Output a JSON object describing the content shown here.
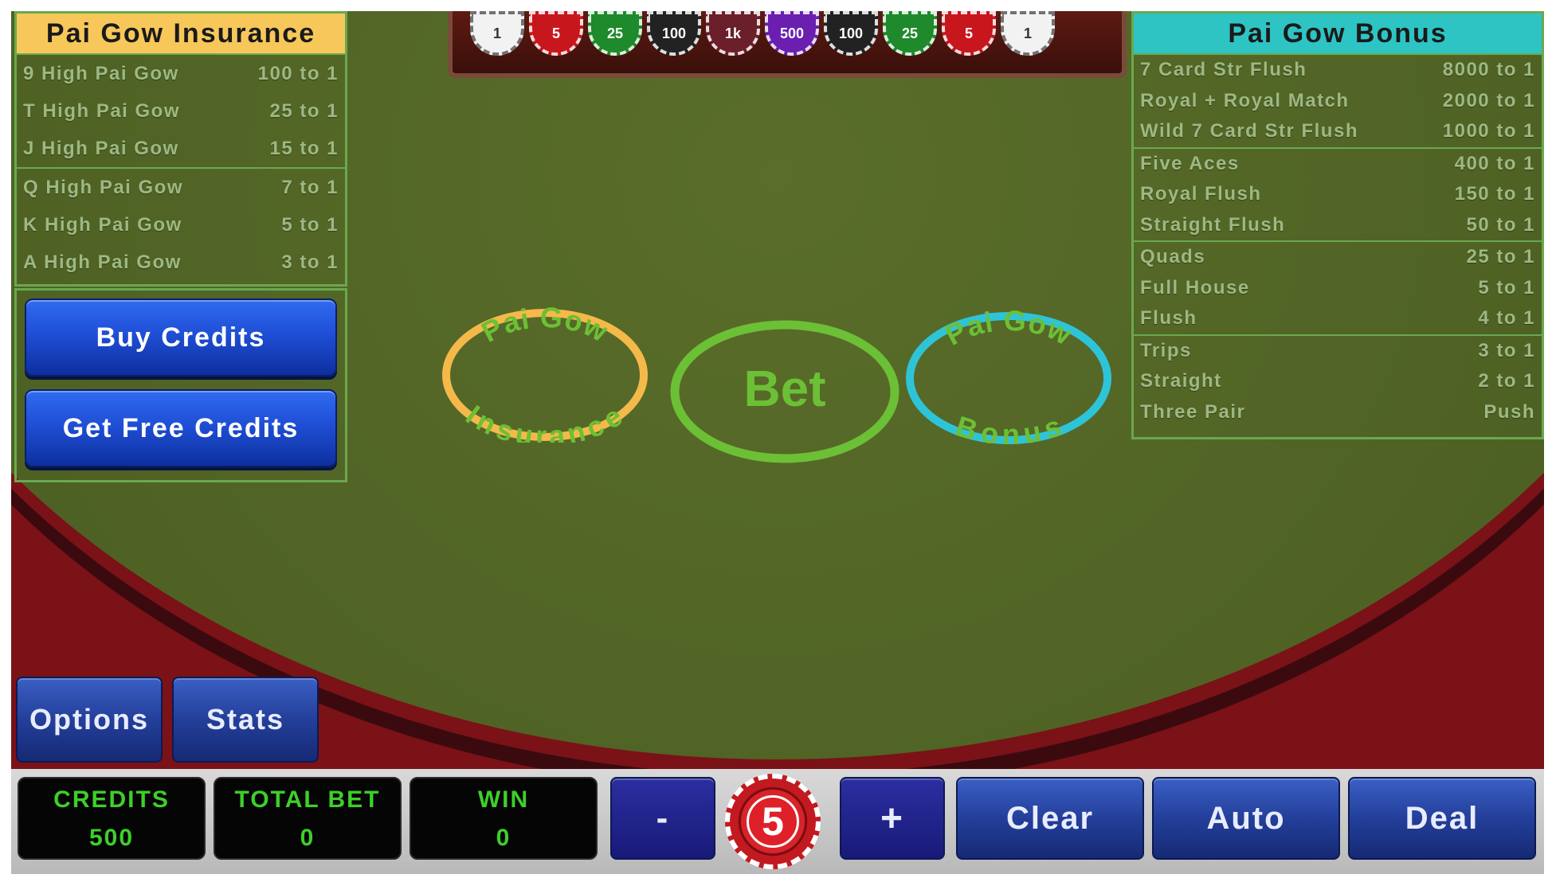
{
  "tray": {
    "chips": [
      {
        "label": "1",
        "color": "#f2f2f2"
      },
      {
        "label": "5",
        "color": "#c8161d"
      },
      {
        "label": "25",
        "color": "#1e8a2b"
      },
      {
        "label": "100",
        "color": "#222222"
      },
      {
        "label": "1k",
        "color": "#6b1f2a"
      },
      {
        "label": "500",
        "color": "#6a1fb0"
      },
      {
        "label": "100",
        "color": "#222222"
      },
      {
        "label": "25",
        "color": "#1e8a2b"
      },
      {
        "label": "5",
        "color": "#c8161d"
      },
      {
        "label": "1",
        "color": "#f2f2f2"
      }
    ]
  },
  "insurance": {
    "title": "Pai Gow Insurance",
    "header_color": "#f7c75a",
    "groups": [
      [
        {
          "hand": "9 High Pai Gow",
          "pay": "100 to 1"
        },
        {
          "hand": "T High Pai Gow",
          "pay": "25 to 1"
        },
        {
          "hand": "J High Pai Gow",
          "pay": "15 to 1"
        }
      ],
      [
        {
          "hand": "Q High Pai Gow",
          "pay": "7 to 1"
        },
        {
          "hand": "K High Pai Gow",
          "pay": "5 to 1"
        },
        {
          "hand": "A High Pai Gow",
          "pay": "3 to 1"
        }
      ]
    ]
  },
  "bonus": {
    "title": "Pai Gow Bonus",
    "header_color": "#2ec4c4",
    "groups": [
      [
        {
          "hand": "7 Card Str Flush",
          "pay": "8000 to 1"
        },
        {
          "hand": "Royal + Royal Match",
          "pay": "2000 to 1"
        },
        {
          "hand": "Wild 7 Card Str Flush",
          "pay": "1000 to 1"
        }
      ],
      [
        {
          "hand": "Five Aces",
          "pay": "400 to 1"
        },
        {
          "hand": "Royal Flush",
          "pay": "150 to 1"
        },
        {
          "hand": "Straight Flush",
          "pay": "50 to 1"
        }
      ],
      [
        {
          "hand": "Quads",
          "pay": "25 to 1"
        },
        {
          "hand": "Full House",
          "pay": "5 to 1"
        },
        {
          "hand": "Flush",
          "pay": "4 to 1"
        }
      ],
      [
        {
          "hand": "Trips",
          "pay": "3 to 1"
        },
        {
          "hand": "Straight",
          "pay": "2 to 1"
        },
        {
          "hand": "Three Pair",
          "pay": "Push"
        }
      ]
    ]
  },
  "credits_panel": {
    "buy_label": "Buy Credits",
    "free_label": "Get Free Credits"
  },
  "spots": {
    "insurance_top": "Pai Gow",
    "insurance_bottom": "Insurance",
    "insurance_color": "#f5b94a",
    "bet": "Bet",
    "bet_color": "#6cc035",
    "bonus_top": "Pai Gow",
    "bonus_bottom": "Bonus",
    "bonus_color": "#2ec4d8"
  },
  "nav": {
    "options_label": "Options",
    "stats_label": "Stats"
  },
  "meters": {
    "credits_label": "CREDITS",
    "credits_value": "500",
    "total_bet_label": "TOTAL BET",
    "total_bet_value": "0",
    "win_label": "WIN",
    "win_value": "0"
  },
  "controls": {
    "minus_label": "-",
    "chip_value": "5",
    "plus_label": "+",
    "clear_label": "Clear",
    "auto_label": "Auto",
    "deal_label": "Deal"
  }
}
